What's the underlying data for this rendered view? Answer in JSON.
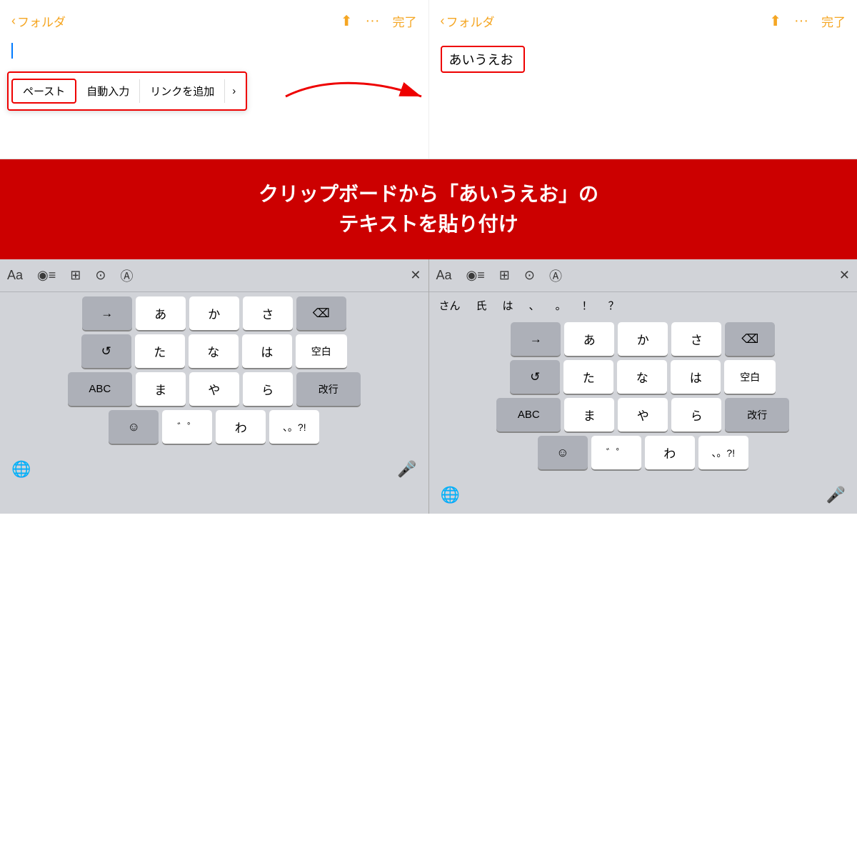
{
  "panels": [
    {
      "id": "left",
      "nav": {
        "back_label": "フォルダ",
        "done_label": "完了"
      },
      "note_text": "",
      "context_menu": {
        "items": [
          "ペースト",
          "自動入力",
          "リンクを追加"
        ],
        "show_arrow": true
      }
    },
    {
      "id": "right",
      "nav": {
        "back_label": "フォルダ",
        "done_label": "完了"
      },
      "note_text": "あいうえお"
    }
  ],
  "explanation": "クリップボードから「あいうえお」の\nテキストを貼り付け",
  "keyboards": [
    {
      "id": "left-kb",
      "toolbar_icons": [
        "Aa",
        "◉≡",
        "⊞",
        "⊙",
        "Ⓐ"
      ],
      "has_suggestions": false,
      "rows": [
        [
          "→",
          "あ",
          "か",
          "さ",
          "⌫"
        ],
        [
          "↺",
          "た",
          "な",
          "は",
          "空白"
        ],
        [
          "ABC",
          "ま",
          "や",
          "ら",
          ""
        ],
        [
          "☺",
          "゛゜",
          "わ",
          "、。?!",
          "改行"
        ]
      ]
    },
    {
      "id": "right-kb",
      "toolbar_icons": [
        "Aa",
        "◉≡",
        "⊞",
        "⊙",
        "Ⓐ"
      ],
      "has_suggestions": true,
      "suggestions": [
        "さん",
        "氏",
        "は",
        "、",
        "。",
        "！",
        "？"
      ],
      "rows": [
        [
          "→",
          "あ",
          "か",
          "さ",
          "⌫"
        ],
        [
          "↺",
          "た",
          "な",
          "は",
          "空白"
        ],
        [
          "ABC",
          "ま",
          "や",
          "ら",
          ""
        ],
        [
          "☺",
          "゛゜",
          "わ",
          "、。?!",
          "改行"
        ]
      ]
    }
  ],
  "icons": {
    "share": "⬆",
    "more": "…",
    "back_chevron": "‹",
    "globe": "🌐",
    "mic": "🎤",
    "close": "✕"
  }
}
